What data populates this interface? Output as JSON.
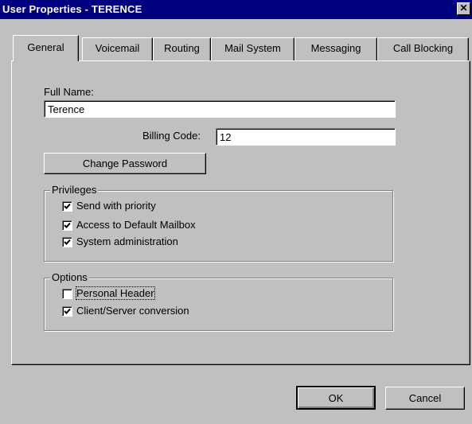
{
  "window": {
    "title": "User Properties - TERENCE",
    "close_glyph": "✕"
  },
  "tabs": [
    {
      "label": "General",
      "active": true
    },
    {
      "label": "Voicemail",
      "active": false
    },
    {
      "label": "Routing",
      "active": false
    },
    {
      "label": "Mail System",
      "active": false
    },
    {
      "label": "Messaging",
      "active": false
    },
    {
      "label": "Call Blocking",
      "active": false
    }
  ],
  "general": {
    "full_name_label": "Full Name:",
    "full_name_value": "Terence",
    "billing_code_label": "Billing Code:",
    "billing_code_value": "12",
    "change_password_label": "Change Password"
  },
  "privileges": {
    "title": "Privileges",
    "items": [
      {
        "label": "Send with priority",
        "checked": true
      },
      {
        "label": "Access to Default Mailbox",
        "checked": true
      },
      {
        "label": "System administration",
        "checked": true
      }
    ]
  },
  "options": {
    "title": "Options",
    "items": [
      {
        "label": "Personal Header",
        "checked": false
      },
      {
        "label": "Client/Server conversion",
        "checked": true
      }
    ]
  },
  "footer": {
    "ok_label": "OK",
    "cancel_label": "Cancel"
  }
}
